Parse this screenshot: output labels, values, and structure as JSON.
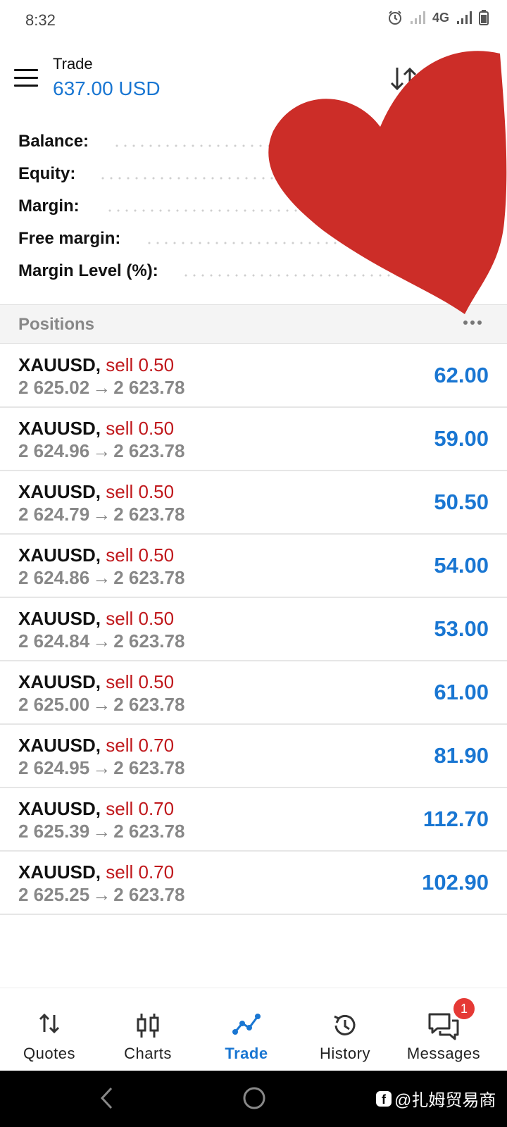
{
  "status_bar": {
    "time": "8:32",
    "network": "4G"
  },
  "header": {
    "title": "Trade",
    "balance": "637.00 USD"
  },
  "summary": [
    {
      "label": "Balance:"
    },
    {
      "label": "Equity:"
    },
    {
      "label": "Margin:"
    },
    {
      "label": "Free margin:"
    },
    {
      "label": "Margin Level (%):"
    }
  ],
  "positions": {
    "title": "Positions",
    "rows": [
      {
        "symbol": "XAUUSD",
        "side": "sell 0.50",
        "open": "2 625.02",
        "current": "2 623.78",
        "profit": "62.00"
      },
      {
        "symbol": "XAUUSD",
        "side": "sell 0.50",
        "open": "2 624.96",
        "current": "2 623.78",
        "profit": "59.00"
      },
      {
        "symbol": "XAUUSD",
        "side": "sell 0.50",
        "open": "2 624.79",
        "current": "2 623.78",
        "profit": "50.50"
      },
      {
        "symbol": "XAUUSD",
        "side": "sell 0.50",
        "open": "2 624.86",
        "current": "2 623.78",
        "profit": "54.00"
      },
      {
        "symbol": "XAUUSD",
        "side": "sell 0.50",
        "open": "2 624.84",
        "current": "2 623.78",
        "profit": "53.00"
      },
      {
        "symbol": "XAUUSD",
        "side": "sell 0.50",
        "open": "2 625.00",
        "current": "2 623.78",
        "profit": "61.00"
      },
      {
        "symbol": "XAUUSD",
        "side": "sell 0.70",
        "open": "2 624.95",
        "current": "2 623.78",
        "profit": "81.90"
      },
      {
        "symbol": "XAUUSD",
        "side": "sell 0.70",
        "open": "2 625.39",
        "current": "2 623.78",
        "profit": "112.70"
      },
      {
        "symbol": "XAUUSD",
        "side": "sell 0.70",
        "open": "2 625.25",
        "current": "2 623.78",
        "profit": "102.90"
      }
    ]
  },
  "bottom_nav": [
    {
      "label": "Quotes",
      "icon": "quotes-icon"
    },
    {
      "label": "Charts",
      "icon": "charts-icon"
    },
    {
      "label": "Trade",
      "icon": "trade-icon",
      "active": true
    },
    {
      "label": "History",
      "icon": "history-icon"
    },
    {
      "label": "Messages",
      "icon": "messages-icon",
      "badge": "1"
    }
  ],
  "watermark": {
    "text": "@扎姆贸易商"
  },
  "colors": {
    "accent": "#1976d2",
    "sell": "#c0181c",
    "heart": "#cc2d28",
    "badge": "#e53935"
  }
}
